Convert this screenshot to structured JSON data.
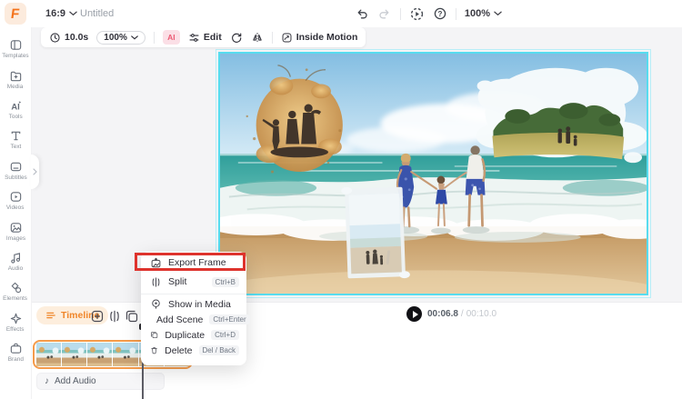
{
  "brand": {
    "logo_letter": "F"
  },
  "header": {
    "aspect_ratio": "16:9",
    "project_title": "Untitled",
    "zoom_level": "100%",
    "help_glyph": "?"
  },
  "sidebar": {
    "items": [
      {
        "label": "Templates"
      },
      {
        "label": "Media"
      },
      {
        "label": "Tools"
      },
      {
        "label": "Text"
      },
      {
        "label": "Subtitles"
      },
      {
        "label": "Videos"
      },
      {
        "label": "Images"
      },
      {
        "label": "Audio"
      },
      {
        "label": "Elements"
      },
      {
        "label": "Effects"
      },
      {
        "label": "Brand"
      }
    ]
  },
  "edit_toolbar": {
    "duration": "10.0s",
    "zoom_level": "100%",
    "ai_badge": "AI",
    "edit_label": "Edit",
    "inside_motion_label": "Inside Motion"
  },
  "context_menu": {
    "items": [
      {
        "label": "Export Frame"
      },
      {
        "label": "Split",
        "shortcut": "Ctrl+B"
      },
      {
        "label": "Show in Media"
      },
      {
        "label": "Add Scene",
        "shortcut": "Ctrl+Enter"
      },
      {
        "label": "Duplicate",
        "shortcut": "Ctrl+D"
      },
      {
        "label": "Delete",
        "shortcut": "Del / Back"
      }
    ]
  },
  "timeline": {
    "tab_label": "Timeline",
    "add_audio_label": "Add Audio",
    "music_note_glyph": "♪"
  },
  "playback": {
    "current_time": "00:06.8",
    "time_separator": "/",
    "total_time": "00:10.0"
  },
  "colors": {
    "accent_orange": "#f5862c",
    "selection_cyan": "#57dcef",
    "highlight_red": "#de332d",
    "timeline_tab_bg": "#fdeedd"
  }
}
